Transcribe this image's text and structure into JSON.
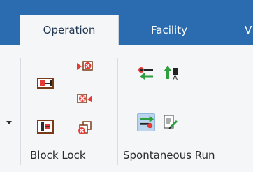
{
  "tabs": [
    {
      "label": "Operation"
    },
    {
      "label": "Facility"
    },
    {
      "label": "V"
    }
  ],
  "groups": {
    "block_lock": {
      "label": "Block Lock"
    },
    "spontaneous_run": {
      "label": "Spontaneous Run"
    }
  },
  "colors": {
    "tab_bar": "#2b6cb0",
    "ribbon_bg": "#f5f6f7",
    "selected_bg": "#bcd5ef",
    "icon_red": "#e53935",
    "icon_green": "#2e9e3f"
  }
}
